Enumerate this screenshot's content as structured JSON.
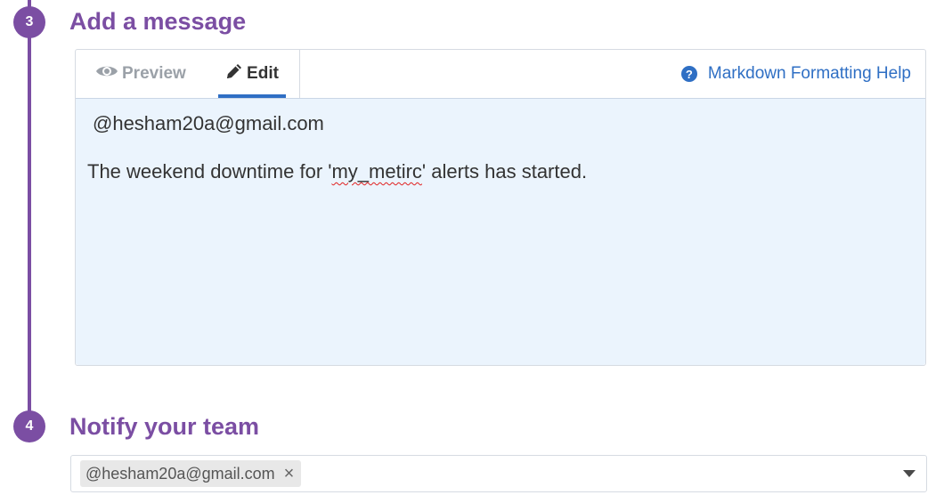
{
  "steps": {
    "message": {
      "number": "3",
      "title": "Add a message"
    },
    "notify": {
      "number": "4",
      "title": "Notify your team"
    }
  },
  "editor": {
    "tabs": {
      "preview": "Preview",
      "edit": "Edit"
    },
    "help_link": "Markdown Formatting Help",
    "content": {
      "line1": "@hesham20a@gmail.com",
      "line2_before": "The weekend downtime for '",
      "line2_misspelled": "my_metirc",
      "line2_after": "' alerts has started."
    }
  },
  "notify": {
    "chips": [
      "@hesham20a@gmail.com"
    ]
  },
  "colors": {
    "accent_purple": "#7b4ea3",
    "link_blue": "#2f6fc4",
    "textarea_bg": "#ebf4fd"
  },
  "icons": {
    "preview": "eye-icon",
    "edit": "pencil-icon",
    "help": "question-circle-icon",
    "chip_remove": "close-icon",
    "dropdown": "caret-down-icon"
  }
}
